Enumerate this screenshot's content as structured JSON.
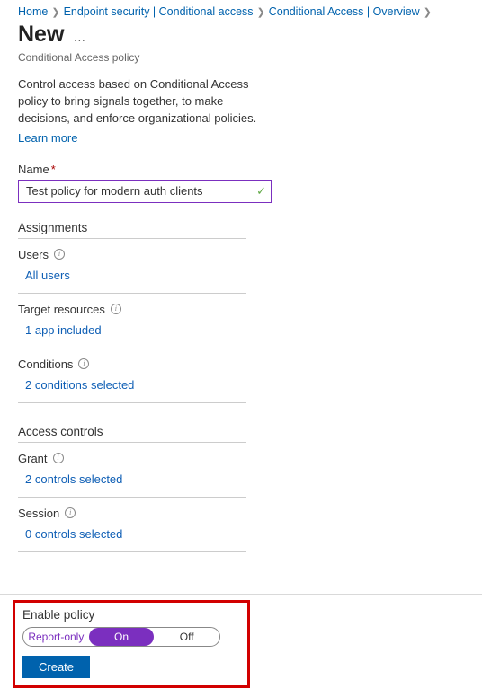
{
  "breadcrumbs": {
    "home": "Home",
    "endpoint": "Endpoint security | Conditional access",
    "overview": "Conditional Access | Overview"
  },
  "header": {
    "title": "New",
    "subtitle": "Conditional Access policy"
  },
  "intro": {
    "text": "Control access based on Conditional Access policy to bring signals together, to make decisions, and enforce organizational policies.",
    "learn": "Learn more"
  },
  "name": {
    "label": "Name",
    "value": "Test policy for modern auth clients"
  },
  "assignments": {
    "title": "Assignments",
    "users": {
      "label": "Users",
      "value": "All users"
    },
    "target": {
      "label": "Target resources",
      "value": "1 app included"
    },
    "conditions": {
      "label": "Conditions",
      "value": "2 conditions selected"
    }
  },
  "access": {
    "title": "Access controls",
    "grant": {
      "label": "Grant",
      "value": "2 controls selected"
    },
    "session": {
      "label": "Session",
      "value": "0 controls selected"
    }
  },
  "footer": {
    "enable_label": "Enable policy",
    "seg": {
      "report": "Report-only",
      "on": "On",
      "off": "Off"
    },
    "create": "Create"
  }
}
